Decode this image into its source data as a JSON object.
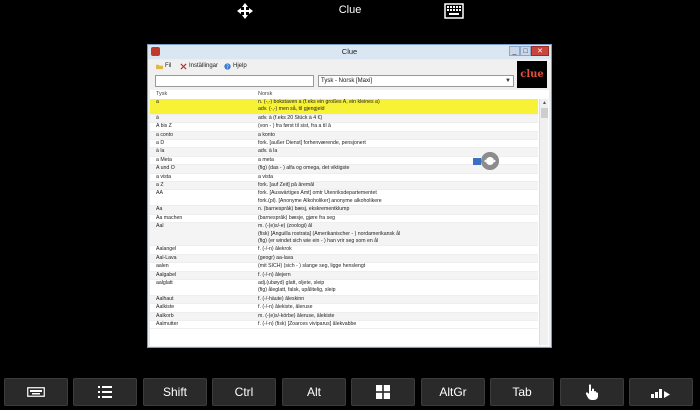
{
  "remote": {
    "title": "Clue"
  },
  "window": {
    "title": "Clue",
    "controls": {
      "minimize": "_",
      "maximize": "□",
      "close": "✕"
    }
  },
  "menu": [
    {
      "label": "Fil",
      "icon": "folder-icon"
    },
    {
      "label": "Inställingar",
      "icon": "tools-icon"
    },
    {
      "label": "Hjelp",
      "icon": "help-icon"
    }
  ],
  "search": {
    "value": ""
  },
  "language": {
    "selected": "Tysk - Norsk [Maxi]"
  },
  "logo": {
    "text": "clue"
  },
  "list": {
    "headers": {
      "source": "Tysk",
      "target": "Norsk"
    },
    "rows": [
      {
        "src": "a",
        "dst": [
          "n. (-,-) bokstaven a (f.eks ein großes A, ein kleines a)",
          "adv. (-,-) men så, til gjengjeld"
        ],
        "highlight": true
      },
      {
        "src": "à",
        "dst": [
          "adv. à (f.eks 20 Stück à 4 €)"
        ]
      },
      {
        "src": "A bis Z",
        "dst": [
          "(von - ) fra først til sist, fra a til å"
        ]
      },
      {
        "src": "a conto",
        "dst": [
          "a konto"
        ]
      },
      {
        "src": "a D",
        "dst": [
          "fork. [außer Dienst] forhenværende, pensjonert"
        ]
      },
      {
        "src": "à la",
        "dst": [
          "adv. à la"
        ]
      },
      {
        "src": "a Meta",
        "dst": [
          "a meta"
        ]
      },
      {
        "src": "A und O",
        "dst": [
          "(fig) (das - ) alfa og omega, det viktigste"
        ]
      },
      {
        "src": "a vista",
        "dst": [
          "a vista"
        ]
      },
      {
        "src": "a Z",
        "dst": [
          "fork. [auf Zeit] på åremål"
        ]
      },
      {
        "src": "AA",
        "dst": [
          "fork. [Auswärtiges Amt] omtr Utenriksdepartementet",
          "fork.(pl). [Anonyme Alkoholiker] anonyme alkoholikere"
        ]
      },
      {
        "src": "Aa",
        "dst": [
          "n. (barnespråk) bæsj, ekskrementklump"
        ]
      },
      {
        "src": "Aa machen",
        "dst": [
          "(barnespråk) bæsje, gjøre fra seg"
        ]
      },
      {
        "src": "Aal",
        "dst": [
          "m. (-(e)s/-e) (zoologi) ål",
          "(fisk) [Anguilla rostrata] (Amerikanischer - ) nordamerikansk ål",
          "(fig) (er windet sich wie ein - ) han vrir seg som en ål"
        ]
      },
      {
        "src": "Aalangel",
        "dst": [
          "f. (-/-n) ålekrok"
        ]
      },
      {
        "src": "Aal-Lava",
        "dst": [
          "(geogr) aa-lava"
        ]
      },
      {
        "src": "aalen",
        "dst": [
          "(mit SICH) (sich - ) slange seg, ligge henslengt"
        ]
      },
      {
        "src": "Aalgabel",
        "dst": [
          "f. (-/-n) ålejern"
        ]
      },
      {
        "src": "aalglatt",
        "dst": [
          "adj.(ubøyd) glatt, oljete, sleip",
          "(fig) åleglatt, falsk, upålitelig, sleip"
        ]
      },
      {
        "src": "Aalhaut",
        "dst": [
          "f. (-/-häute) åleskinn"
        ]
      },
      {
        "src": "Aalkiste",
        "dst": [
          "f. (-/-n) ålekiste, åleruse"
        ]
      },
      {
        "src": "Aalkorb",
        "dst": [
          "m. (-(e)s/-körbe) åleruse, ålekiste"
        ]
      },
      {
        "src": "Aalmutter",
        "dst": [
          "f. (-/-n) (fisk) [Zoarces viviparus] ålekvabbe"
        ]
      }
    ]
  },
  "toolbar": {
    "shift": "Shift",
    "ctrl": "Ctrl",
    "alt": "Alt",
    "altgr": "AltGr",
    "tab": "Tab"
  },
  "colors": {
    "highlight": "#f7f236",
    "link": "#2c48c9",
    "grammar": "#2a8c2a"
  }
}
